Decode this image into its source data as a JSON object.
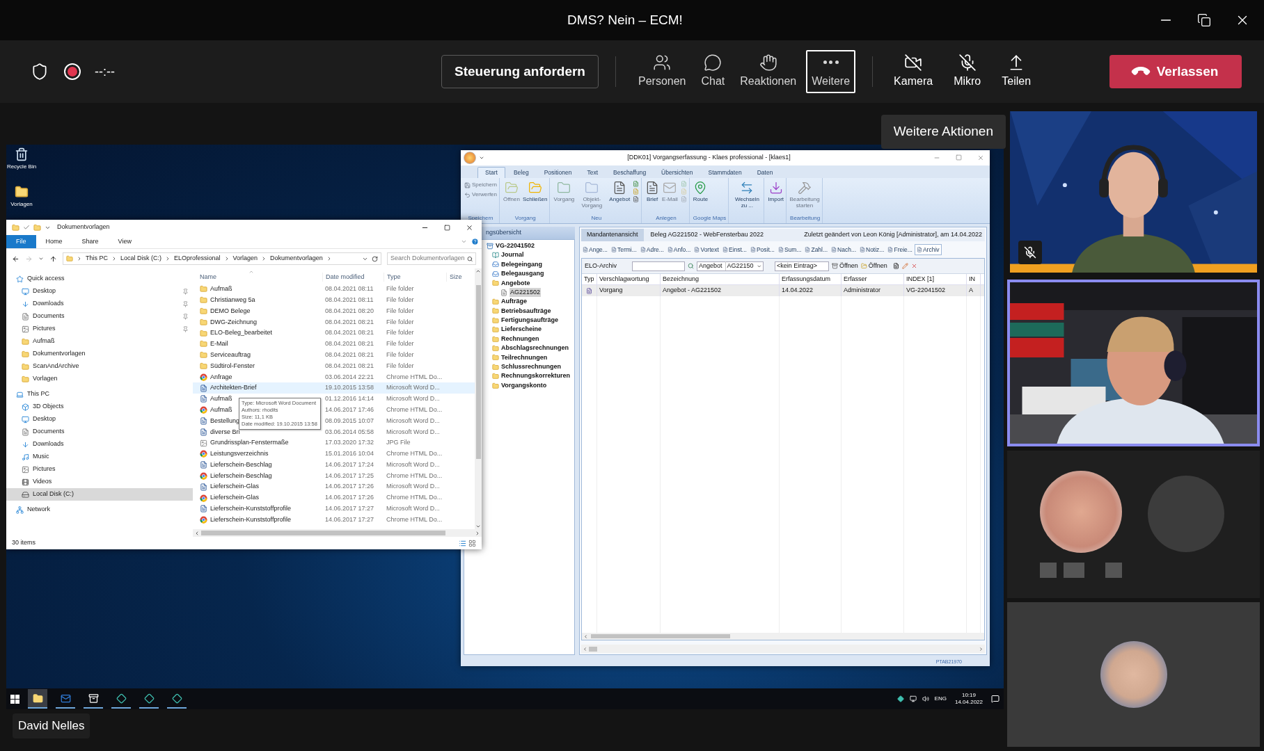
{
  "window": {
    "title": "DMS? Nein – ECM!"
  },
  "meeting_toolbar": {
    "timer": "--:--",
    "control_button": "Steuerung anfordern",
    "actions": [
      {
        "label": "Personen",
        "selected": false
      },
      {
        "label": "Chat",
        "selected": false
      },
      {
        "label": "Reaktionen",
        "selected": false
      },
      {
        "label": "Weitere",
        "selected": true
      }
    ],
    "devices": [
      {
        "label": "Kamera"
      },
      {
        "label": "Mikro"
      },
      {
        "label": "Teilen"
      }
    ],
    "leave_button": "Verlassen"
  },
  "tooltip": "Weitere Aktionen",
  "shared_screen": {
    "desktop_icons": [
      {
        "label": "Recycle Bin",
        "kind": "recycle"
      },
      {
        "label": "Vorlagen",
        "kind": "folder"
      }
    ],
    "explorer": {
      "title": "Dokumentvorlagen",
      "ribbon_tabs": [
        {
          "label": "File",
          "selected": true
        },
        {
          "label": "Home",
          "selected": false
        },
        {
          "label": "Share",
          "selected": false
        },
        {
          "label": "View",
          "selected": false
        }
      ],
      "path": [
        "This PC",
        "Local Disk (C:)",
        "ELOprofessional",
        "Vorlagen",
        "Dokumentvorlagen"
      ],
      "search": {
        "placeholder": "Search Dokumentvorlagen"
      },
      "navigation": [
        {
          "label": "Quick access",
          "kind": "star",
          "selected": false,
          "children": [
            {
              "label": "Desktop",
              "kind": "desktop",
              "selected": false,
              "pinned": true
            },
            {
              "label": "Downloads",
              "kind": "downloads",
              "selected": false,
              "pinned": true
            },
            {
              "label": "Documents",
              "kind": "documents",
              "selected": false,
              "pinned": true
            },
            {
              "label": "Pictures",
              "kind": "pictures",
              "selected": false,
              "pinned": true
            },
            {
              "label": "Aufmaß",
              "kind": "folder",
              "selected": false,
              "pinned": false
            },
            {
              "label": "Dokumentvorlagen",
              "kind": "folder",
              "selected": false,
              "pinned": false
            },
            {
              "label": "ScanAndArchive",
              "kind": "folder",
              "selected": false,
              "pinned": false
            },
            {
              "label": "Vorlagen",
              "kind": "folder",
              "selected": false,
              "pinned": false
            }
          ]
        },
        {
          "label": "This PC",
          "kind": "pc",
          "selected": false,
          "children": [
            {
              "label": "3D Objects",
              "kind": "cube",
              "selected": false
            },
            {
              "label": "Desktop",
              "kind": "desktop",
              "selected": false
            },
            {
              "label": "Documents",
              "kind": "documents",
              "selected": false
            },
            {
              "label": "Downloads",
              "kind": "downloads",
              "selected": false
            },
            {
              "label": "Music",
              "kind": "music",
              "selected": false
            },
            {
              "label": "Pictures",
              "kind": "pictures",
              "selected": false
            },
            {
              "label": "Videos",
              "kind": "videos",
              "selected": false
            },
            {
              "label": "Local Disk (C:)",
              "kind": "disk",
              "selected": true
            }
          ]
        },
        {
          "label": "Network",
          "kind": "network",
          "selected": false
        }
      ],
      "columns": [
        "Name",
        "Date modified",
        "Type",
        "Size"
      ],
      "files": [
        {
          "name": "Aufmaß",
          "date": "08.04.2021 08:11",
          "type": "File folder",
          "kind": "folder",
          "selected": false
        },
        {
          "name": "Christianweg 5a",
          "date": "08.04.2021 08:11",
          "type": "File folder",
          "kind": "folder",
          "selected": false
        },
        {
          "name": "DEMO Belege",
          "date": "08.04.2021 08:20",
          "type": "File folder",
          "kind": "folder",
          "selected": false
        },
        {
          "name": "DWG-Zeichnung",
          "date": "08.04.2021 08:21",
          "type": "File folder",
          "kind": "folder",
          "selected": false
        },
        {
          "name": "ELO-Beleg_bearbeitet",
          "date": "08.04.2021 08:21",
          "type": "File folder",
          "kind": "folder",
          "selected": false
        },
        {
          "name": "E-Mail",
          "date": "08.04.2021 08:21",
          "type": "File folder",
          "kind": "folder",
          "selected": false
        },
        {
          "name": "Serviceauftrag",
          "date": "08.04.2021 08:21",
          "type": "File folder",
          "kind": "folder",
          "selected": false
        },
        {
          "name": "Südtirol-Fenster",
          "date": "08.04.2021 08:21",
          "type": "File folder",
          "kind": "folder",
          "selected": false
        },
        {
          "name": "Anfrage",
          "date": "03.06.2014 22:21",
          "type": "Chrome HTML Do...",
          "kind": "chrome",
          "selected": false
        },
        {
          "name": "Architekten-Brief",
          "date": "19.10.2015 13:58",
          "type": "Microsoft Word D...",
          "kind": "word",
          "selected": true
        },
        {
          "name": "Aufmaß",
          "date": "01.12.2016 14:14",
          "type": "Microsoft Word D...",
          "kind": "word",
          "selected": false
        },
        {
          "name": "Aufmaß",
          "date": "14.06.2017 17:46",
          "type": "Chrome HTML Do...",
          "kind": "chrome",
          "selected": false
        },
        {
          "name": "Bestellung",
          "date": "08.09.2015 10:07",
          "type": "Microsoft Word D...",
          "kind": "word",
          "selected": false
        },
        {
          "name": "diverse Bri",
          "date": "03.06.2014 05:58",
          "type": "Microsoft Word D...",
          "kind": "word",
          "selected": false
        },
        {
          "name": "Grundrissplan-Fenstermaße",
          "date": "17.03.2020 17:32",
          "type": "JPG File",
          "kind": "jpg",
          "selected": false
        },
        {
          "name": "Leistungsverzeichnis",
          "date": "15.01.2016 10:04",
          "type": "Chrome HTML Do...",
          "kind": "chrome",
          "selected": false
        },
        {
          "name": "Lieferschein-Beschlag",
          "date": "14.06.2017 17:24",
          "type": "Microsoft Word D...",
          "kind": "word",
          "selected": false
        },
        {
          "name": "Lieferschein-Beschlag",
          "date": "14.06.2017 17:25",
          "type": "Chrome HTML Do...",
          "kind": "chrome",
          "selected": false
        },
        {
          "name": "Lieferschein-Glas",
          "date": "14.06.2017 17:26",
          "type": "Microsoft Word D...",
          "kind": "word",
          "selected": false
        },
        {
          "name": "Lieferschein-Glas",
          "date": "14.06.2017 17:26",
          "type": "Chrome HTML Do...",
          "kind": "chrome",
          "selected": false
        },
        {
          "name": "Lieferschein-Kunststoffprofile",
          "date": "14.06.2017 17:27",
          "type": "Microsoft Word D...",
          "kind": "word",
          "selected": false
        },
        {
          "name": "Lieferschein-Kunststoffprofile",
          "date": "14.06.2017 17:27",
          "type": "Chrome HTML Do...",
          "kind": "chrome",
          "selected": false
        }
      ],
      "file_tooltip": [
        "Type: Microsoft Word Document",
        "Authors: rhodits",
        "Size: 11,1 KB",
        "Date modified: 19.10.2015 13:58"
      ],
      "status": "30 items"
    },
    "elo": {
      "title": "[DDK01] Vorgangserfassung - Klaes professional - [klaes1]",
      "tabs": [
        {
          "label": "Start",
          "selected": true
        },
        {
          "label": "Beleg",
          "selected": false
        },
        {
          "label": "Positionen",
          "selected": false
        },
        {
          "label": "Text",
          "selected": false
        },
        {
          "label": "Beschaffung",
          "selected": false
        },
        {
          "label": "Übersichten",
          "selected": false
        },
        {
          "label": "Stammdaten",
          "selected": false
        },
        {
          "label": "Daten",
          "selected": false
        }
      ],
      "ribbon_groups": [
        {
          "label": "Speichern",
          "buttons": [
            {
              "kind": "small",
              "label": "Speichern",
              "disabled": true
            },
            {
              "kind": "small",
              "label": "Verwerfen",
              "disabled": true
            }
          ]
        },
        {
          "label": "Vorgang",
          "buttons": [
            {
              "kind": "large",
              "label": "Öffnen",
              "disabled": true
            },
            {
              "kind": "large",
              "label": "Schließen",
              "disabled": false
            }
          ]
        },
        {
          "label": "Neu",
          "buttons": [
            {
              "kind": "large",
              "label": "Vorgang",
              "disabled": true
            },
            {
              "kind": "large",
              "label": "Objekt-Vorgang",
              "disabled": true
            },
            {
              "kind": "large",
              "label": "Angebot",
              "disabled": false
            },
            {
              "kind": "icons",
              "disabled": false
            }
          ]
        },
        {
          "label": "Anlegen",
          "buttons": [
            {
              "kind": "large",
              "label": "Brief",
              "disabled": false
            },
            {
              "kind": "large",
              "label": "E-Mail",
              "disabled": true
            },
            {
              "kind": "icons",
              "disabled": true
            }
          ]
        },
        {
          "label": "Google Maps",
          "buttons": [
            {
              "kind": "large",
              "label": "Route",
              "disabled": false
            }
          ]
        },
        {
          "buttons": [
            {
              "kind": "large",
              "label": "Wechseln zu ...",
              "disabled": false
            }
          ]
        },
        {
          "buttons": [
            {
              "kind": "large",
              "label": "Import",
              "disabled": false
            }
          ]
        },
        {
          "label": "Bearbeitung",
          "buttons": [
            {
              "kind": "large",
              "label": "Bearbeitung starten",
              "disabled": true
            }
          ]
        }
      ],
      "tree_title": "ngsübersicht",
      "tree": [
        {
          "label": "VG-22041502",
          "kind": "root",
          "selected": false,
          "children": [
            {
              "label": "Journal",
              "kind": "journal",
              "selected": false
            },
            {
              "label": "Belegeingang",
              "kind": "inbox",
              "selected": false
            },
            {
              "label": "Belegausgang",
              "kind": "inbox",
              "selected": false
            },
            {
              "label": "Angebote",
              "kind": "folder",
              "selected": false,
              "children": [
                {
                  "label": "AG221502",
                  "kind": "document",
                  "selected": true
                }
              ]
            },
            {
              "label": "Aufträge",
              "kind": "folder",
              "selected": false
            },
            {
              "label": "Betriebsaufträge",
              "kind": "folder",
              "selected": false
            },
            {
              "label": "Fertigungsaufträge",
              "kind": "folder",
              "selected": false
            },
            {
              "label": "Lieferscheine",
              "kind": "folder",
              "selected": false
            },
            {
              "label": "Rechnungen",
              "kind": "folder",
              "selected": false
            },
            {
              "label": "Abschlagsrechnungen",
              "kind": "folder",
              "selected": false
            },
            {
              "label": "Teilrechnungen",
              "kind": "folder",
              "selected": false
            },
            {
              "label": "Schlussrechnungen",
              "kind": "folder",
              "selected": false
            },
            {
              "label": "Rechnungskorrekturen",
              "kind": "folder",
              "selected": false
            },
            {
              "label": "Vorgangskonto",
              "kind": "folder",
              "selected": false
            }
          ]
        }
      ],
      "header": {
        "view": "Mandantenansicht",
        "document": "Beleg AG221502 - WebFensterbau 2022",
        "changed": "Zuletzt geändert von Leon König [Administrator], am 14.04.2022"
      },
      "subtabs": [
        {
          "label": "Ange...",
          "selected": false
        },
        {
          "label": "Termi...",
          "selected": false
        },
        {
          "label": "Adre...",
          "selected": false
        },
        {
          "label": "Anfo...",
          "selected": false
        },
        {
          "label": "Vortext",
          "selected": false
        },
        {
          "label": "Einst...",
          "selected": false
        },
        {
          "label": "Posit...",
          "selected": false
        },
        {
          "label": "Sum...",
          "selected": false
        },
        {
          "label": "Zahl...",
          "selected": false
        },
        {
          "label": "Nach...",
          "selected": false
        },
        {
          "label": "Notiz...",
          "selected": false
        },
        {
          "label": "Freie...",
          "selected": false
        },
        {
          "label": "Archiv",
          "selected": true
        }
      ],
      "archive_bar": {
        "label": "ELO-Archiv",
        "document_type": "Angebot",
        "document_number": "AG22150",
        "entry": "<kein Eintrag>",
        "buttons": [
          "Öffnen",
          "Öffnen"
        ]
      },
      "grid": {
        "columns": [
          "Typ",
          "Verschlagwortung",
          "Bezeichnung",
          "Erfassungsdatum",
          "Erfasser",
          "INDEX [1]",
          "IN"
        ],
        "rows": [
          {
            "cells": [
              "",
              "Vorgang",
              "Angebot - AG221502",
              "14.04.2022",
              "Administrator",
              "VG-22041502",
              "A"
            ]
          }
        ]
      },
      "status": "PTAB21970"
    },
    "taskbar": {
      "apps": [
        {
          "kind": "explorer",
          "selected": true
        },
        {
          "kind": "mail",
          "selected": false
        },
        {
          "kind": "elo",
          "selected": false
        },
        {
          "kind": "app",
          "selected": false
        },
        {
          "kind": "app",
          "selected": false
        },
        {
          "kind": "app",
          "selected": false
        }
      ],
      "language": "ENG",
      "time": "10:19",
      "date": "14.04.2022"
    }
  },
  "presenter_name": "David Nelles",
  "video_tiles": [
    {
      "kind": "picture",
      "muted": true,
      "speaking": false
    },
    {
      "kind": "picture",
      "muted": false,
      "speaking": true
    }
  ]
}
